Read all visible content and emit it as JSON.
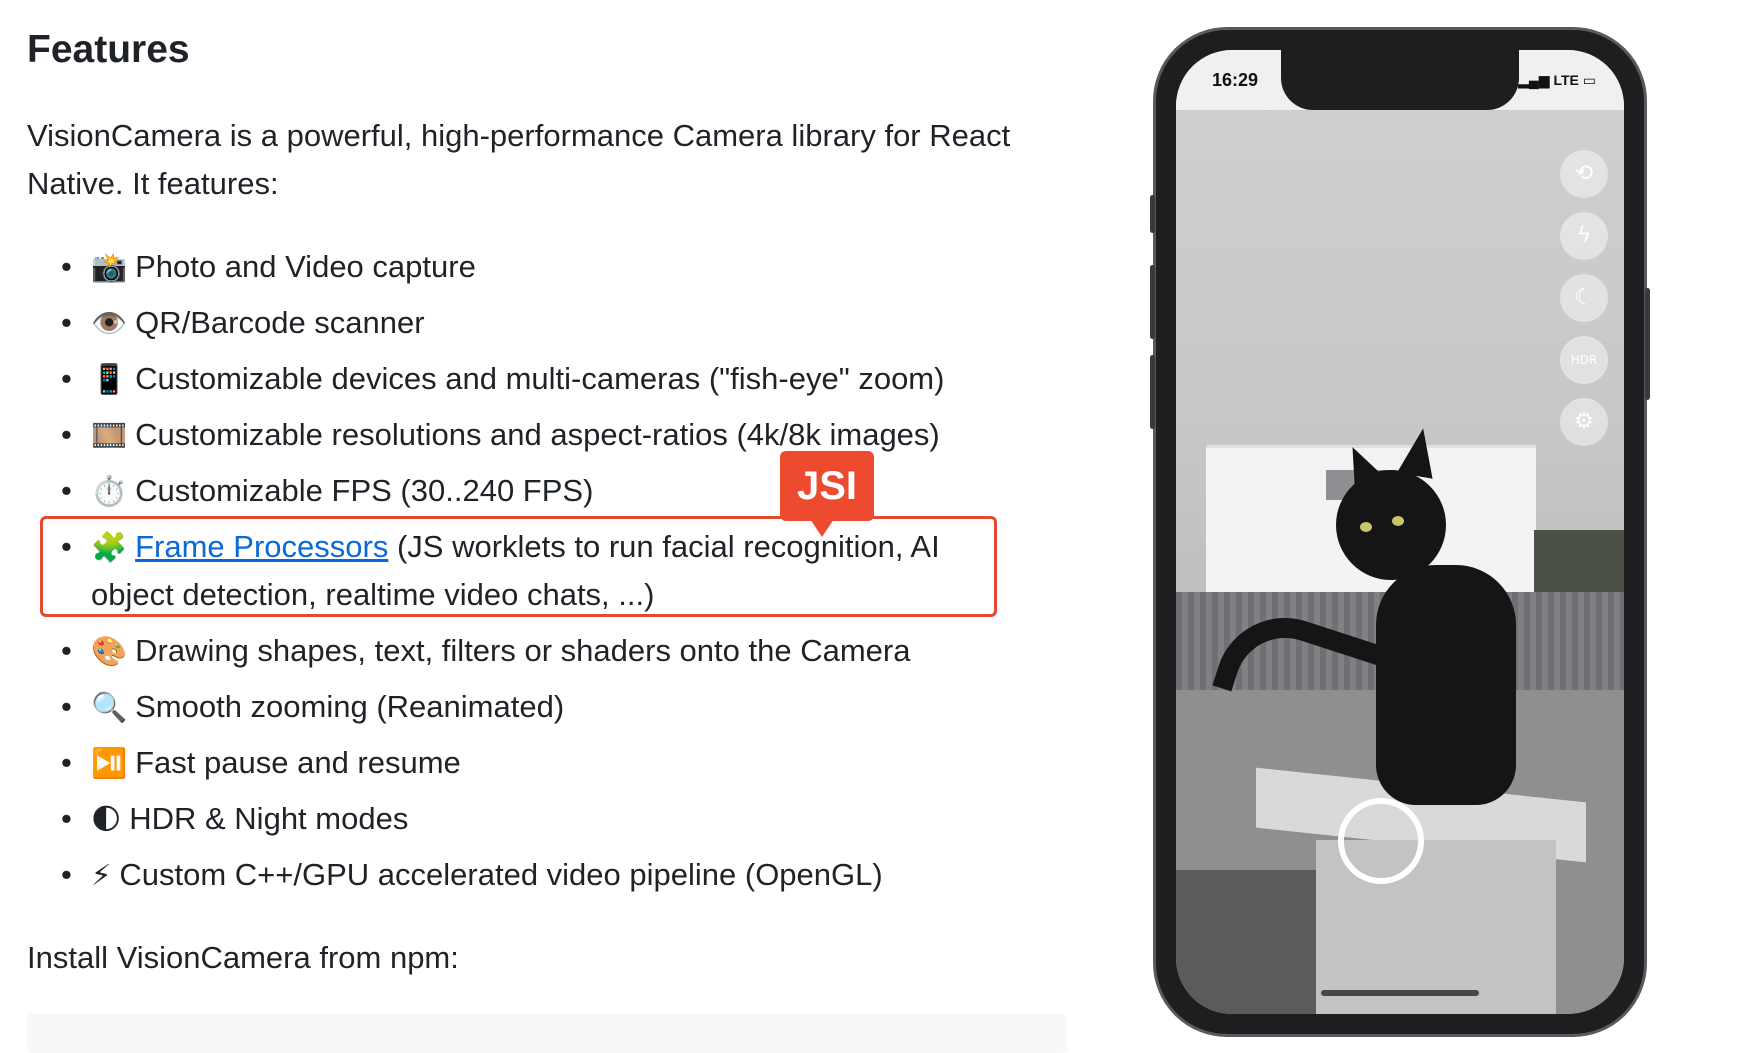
{
  "heading": "Features",
  "intro": "VisionCamera is a powerful, high-performance Camera library for React Native. It features:",
  "features": [
    {
      "emoji": "📸",
      "text": "Photo and Video capture"
    },
    {
      "emoji": "👁️",
      "text": "QR/Barcode scanner"
    },
    {
      "emoji": "📱",
      "text": "Customizable devices and multi-cameras (\"fish-eye\" zoom)"
    },
    {
      "emoji": "🎞️",
      "text": "Customizable resolutions and aspect-ratios (4k/8k images)"
    },
    {
      "emoji": "⏱️",
      "text": "Customizable FPS (30..240 FPS)"
    },
    {
      "emoji": "🧩",
      "link": "Frame Processors",
      "text": " (JS worklets to run facial recognition, AI object detection, realtime video chats, ...)"
    },
    {
      "emoji": "🎨",
      "text": "Drawing shapes, text, filters or shaders onto the Camera"
    },
    {
      "emoji": "🔍",
      "text": "Smooth zooming (Reanimated)"
    },
    {
      "emoji": "⏯️",
      "text": "Fast pause and resume"
    },
    {
      "emoji": "🌓",
      "text": "HDR & Night modes"
    },
    {
      "emoji": "⚡",
      "text": "Custom C++/GPU accelerated video pipeline (OpenGL)"
    }
  ],
  "badge": "JSI",
  "install": "Install VisionCamera from npm:",
  "phone": {
    "time": "16:29",
    "carrier": "LTE",
    "controls": [
      "camera-flip-icon",
      "flash-off-icon",
      "night-mode-icon",
      "hdr-off-icon",
      "settings-icon"
    ]
  },
  "colors": {
    "highlight_border": "#e34a2f",
    "badge_bg": "#ee4a2f",
    "link": "#0969da"
  }
}
